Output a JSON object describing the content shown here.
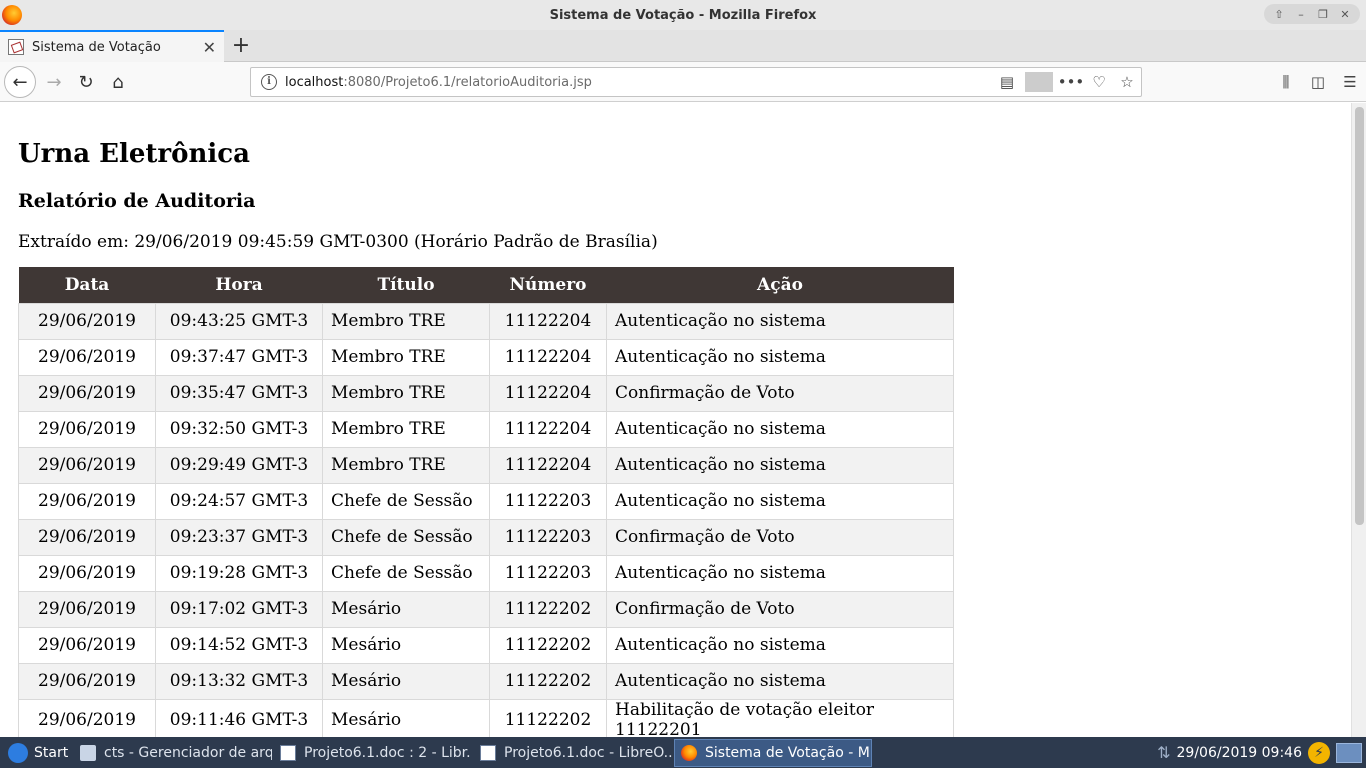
{
  "window": {
    "title": "Sistema de Votação - Mozilla Firefox",
    "controls": [
      "up-icon",
      "minimize-icon",
      "restore-icon",
      "close-icon"
    ]
  },
  "tabs": [
    {
      "label": "Sistema de Votação",
      "active": true
    }
  ],
  "url": {
    "host": "localhost",
    "path": ":8080/Projeto6.1/relatorioAuditoria.jsp"
  },
  "page": {
    "h1": "Urna Eletrônica",
    "h2": "Relatório de Auditoria",
    "extracted": "Extraído em: 29/06/2019 09:45:59 GMT-0300 (Horário Padrão de Brasília)"
  },
  "table": {
    "headers": [
      "Data",
      "Hora",
      "Título",
      "Número",
      "Ação"
    ],
    "rows": [
      [
        "29/06/2019",
        "09:43:25 GMT-3",
        "Membro TRE",
        "11122204",
        "Autenticação no sistema"
      ],
      [
        "29/06/2019",
        "09:37:47 GMT-3",
        "Membro TRE",
        "11122204",
        "Autenticação no sistema"
      ],
      [
        "29/06/2019",
        "09:35:47 GMT-3",
        "Membro TRE",
        "11122204",
        "Confirmação de Voto"
      ],
      [
        "29/06/2019",
        "09:32:50 GMT-3",
        "Membro TRE",
        "11122204",
        "Autenticação no sistema"
      ],
      [
        "29/06/2019",
        "09:29:49 GMT-3",
        "Membro TRE",
        "11122204",
        "Autenticação no sistema"
      ],
      [
        "29/06/2019",
        "09:24:57 GMT-3",
        "Chefe de Sessão",
        "11122203",
        "Autenticação no sistema"
      ],
      [
        "29/06/2019",
        "09:23:37 GMT-3",
        "Chefe de Sessão",
        "11122203",
        "Confirmação de Voto"
      ],
      [
        "29/06/2019",
        "09:19:28 GMT-3",
        "Chefe de Sessão",
        "11122203",
        "Autenticação no sistema"
      ],
      [
        "29/06/2019",
        "09:17:02 GMT-3",
        "Mesário",
        "11122202",
        "Confirmação de Voto"
      ],
      [
        "29/06/2019",
        "09:14:52 GMT-3",
        "Mesário",
        "11122202",
        "Autenticação no sistema"
      ],
      [
        "29/06/2019",
        "09:13:32 GMT-3",
        "Mesário",
        "11122202",
        "Autenticação no sistema"
      ],
      [
        "29/06/2019",
        "09:11:46 GMT-3",
        "Mesário",
        "11122202",
        "Habilitação de votação eleitor 11122201"
      ]
    ]
  },
  "taskbar": {
    "start": "Start",
    "tasks": [
      {
        "label": "cts - Gerenciador de arq...",
        "icon": "folder-icon"
      },
      {
        "label": "Projeto6.1.doc : 2 - Libr...",
        "icon": "document-icon"
      },
      {
        "label": "Projeto6.1.doc - LibreO...",
        "icon": "document-icon"
      },
      {
        "label": "Sistema de Votação - M...",
        "icon": "firefox-icon",
        "active": true
      }
    ],
    "clock": "29/06/2019 09:46"
  },
  "colors": {
    "table_header_bg": "#3f3735",
    "row_alt_bg": "#f2f2f2",
    "tab_accent": "#0a84ff",
    "taskbar_bg": "#2d3a4e"
  }
}
